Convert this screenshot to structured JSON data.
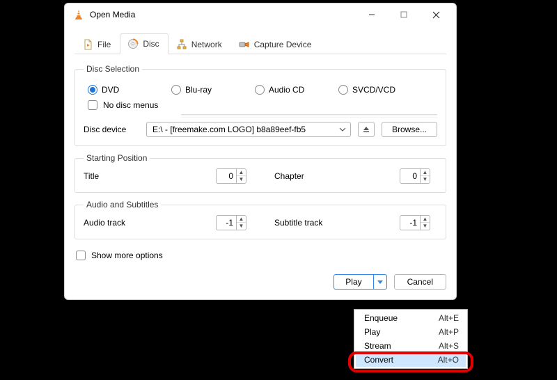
{
  "window": {
    "title": "Open Media"
  },
  "tabs": {
    "file": "File",
    "disc": "Disc",
    "network": "Network",
    "capture": "Capture Device"
  },
  "disc_selection": {
    "legend": "Disc Selection",
    "options": {
      "dvd": "DVD",
      "bluray": "Blu-ray",
      "audiocd": "Audio CD",
      "svcd": "SVCD/VCD"
    },
    "selected": "dvd",
    "no_disc_menus_label": "No disc menus",
    "device_label": "Disc device",
    "device_value": "E:\\ - [freemake.com LOGO] b8a89eef-fb5",
    "browse_label": "Browse..."
  },
  "starting_position": {
    "legend": "Starting Position",
    "title_label": "Title",
    "title_value": "0",
    "chapter_label": "Chapter",
    "chapter_value": "0"
  },
  "audio_subtitles": {
    "legend": "Audio and Subtitles",
    "audio_label": "Audio track",
    "audio_value": "-1",
    "subtitle_label": "Subtitle track",
    "subtitle_value": "-1"
  },
  "show_more_label": "Show more options",
  "footer": {
    "play_label": "Play",
    "cancel_label": "Cancel"
  },
  "menu": {
    "items": [
      {
        "label": "Enqueue",
        "shortcut": "Alt+E"
      },
      {
        "label": "Play",
        "shortcut": "Alt+P"
      },
      {
        "label": "Stream",
        "shortcut": "Alt+S"
      },
      {
        "label": "Convert",
        "shortcut": "Alt+O"
      }
    ],
    "selected_index": 3
  }
}
